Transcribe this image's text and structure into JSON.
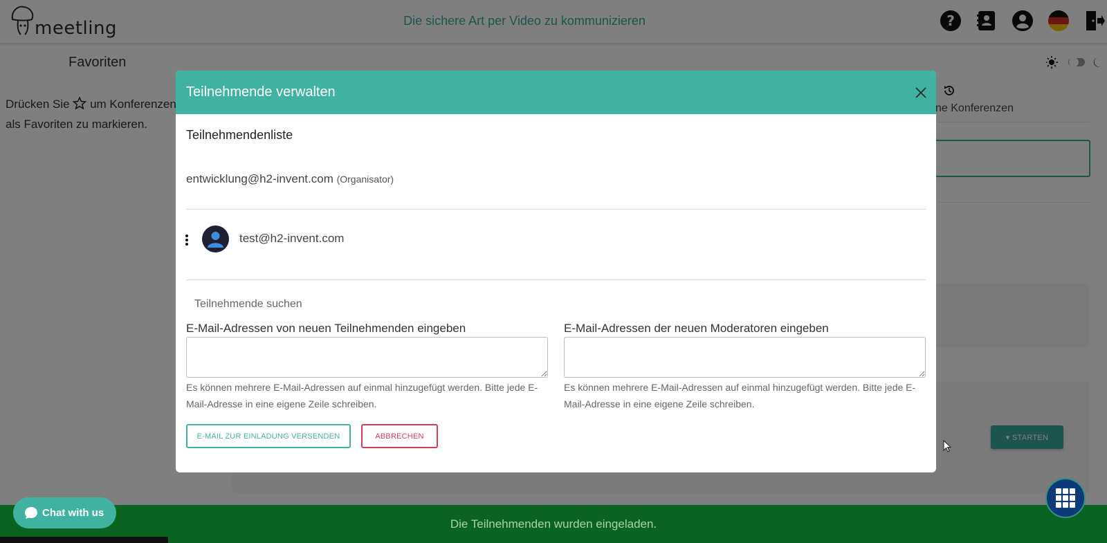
{
  "header": {
    "logo_text": "meetling",
    "tagline": "Die sichere Art per Video zu kommunizieren",
    "icons": [
      "help-icon",
      "contacts-icon",
      "account-icon",
      "german-flag-icon",
      "logout-icon"
    ]
  },
  "favorites": {
    "title": "Favoriten",
    "hint_prefix": "Drücken Sie",
    "hint_suffix": "um Konferenzen als Favoriten zu markieren."
  },
  "recent": {
    "label": "ne Konferenzen"
  },
  "start_button": {
    "label": "STARTEN"
  },
  "modal": {
    "title": "Teilnehmende verwalten",
    "list_title": "Teilnehmendenliste",
    "organizer_email": "entwicklung@h2-invent.com",
    "organizer_tag": "(Organisator)",
    "participants": [
      {
        "email": "test@h2-invent.com"
      }
    ],
    "search_placeholder": "Teilnehmende suchen",
    "participants_field": {
      "label": "E-Mail-Adressen von neuen Teilnehmenden eingeben",
      "value": "",
      "help": "Es können mehrere E-Mail-Adressen auf einmal hinzugefügt werden. Bitte jede E-Mail-Adresse in eine eigene Zeile schreiben."
    },
    "moderators_field": {
      "label": "E-Mail-Adressen der neuen Moderatoren eingeben",
      "value": "",
      "help": "Es können mehrere E-Mail-Adressen auf einmal hinzugefügt werden. Bitte jede E-Mail-Adresse in eine eigene Zeile schreiben."
    },
    "send_button": "E-MAIL ZUR EINLADUNG VERSENDEN",
    "cancel_button": "ABBRECHEN"
  },
  "toast": {
    "message": "Die Teilnehmenden wurden eingeladen."
  },
  "chat": {
    "label": "Chat with us"
  },
  "colors": {
    "primary": "#3fb3a0",
    "danger": "#d83a5a",
    "toast_bg": "#0a6320",
    "grid_button": "#0d3a78"
  }
}
